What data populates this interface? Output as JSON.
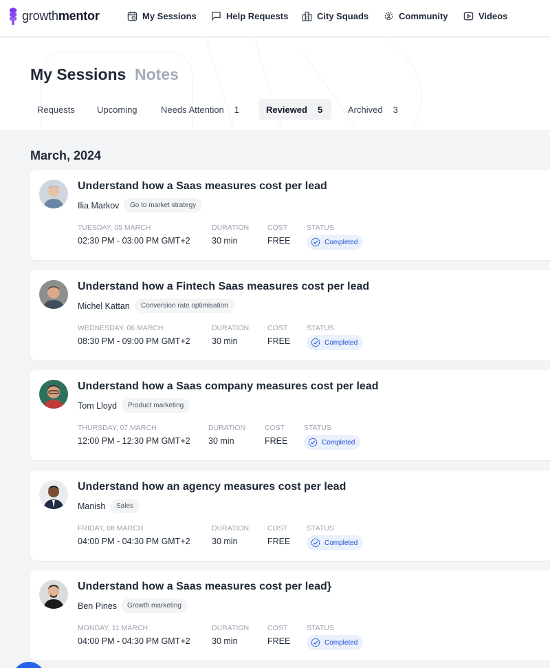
{
  "app": {
    "logo_light": "growth",
    "logo_bold": "mentor",
    "brand_color": "#7c3aed"
  },
  "nav": {
    "items": [
      {
        "label": "My Sessions",
        "icon": "calendar-icon"
      },
      {
        "label": "Help Requests",
        "icon": "chat-flag-icon"
      },
      {
        "label": "City Squads",
        "icon": "city-icon"
      },
      {
        "label": "Community",
        "icon": "gear-people-icon"
      },
      {
        "label": "Videos",
        "icon": "play-icon"
      }
    ]
  },
  "page": {
    "tabs": [
      {
        "label": "My Sessions",
        "active": true
      },
      {
        "label": "Notes",
        "active": false
      }
    ],
    "subtabs": [
      {
        "label": "Requests",
        "count": ""
      },
      {
        "label": "Upcoming",
        "count": ""
      },
      {
        "label": "Needs Attention",
        "count": "1"
      },
      {
        "label": "Reviewed",
        "count": "5",
        "active": true
      },
      {
        "label": "Archived",
        "count": "3"
      }
    ]
  },
  "month_heading": "March, 2024",
  "labels": {
    "duration": "DURATION",
    "cost": "COST",
    "status": "STATUS"
  },
  "sessions": [
    {
      "title": "Understand how a Saas measures cost per lead",
      "mentor": "Ilia Markov",
      "topic": "Go to market strategy",
      "date": "TUESDAY, 05 MARCH",
      "time": "02:30 PM - 03:00 PM GMT+2",
      "duration": "30 min",
      "cost": "FREE",
      "status": "Completed"
    },
    {
      "title": "Understand how a Fintech Saas measures cost per lead",
      "mentor": "Michel Kattan",
      "topic": "Conversion rate optimisation",
      "date": "WEDNESDAY, 06 MARCH",
      "time": "08:30 PM - 09:00 PM GMT+2",
      "duration": "30 min",
      "cost": "FREE",
      "status": "Completed"
    },
    {
      "title": "Understand how a Saas company measures cost per lead",
      "mentor": "Tom Lloyd",
      "topic": "Product marketing",
      "date": "THURSDAY, 07 MARCH",
      "time": "12:00 PM - 12:30 PM GMT+2",
      "duration": "30 min",
      "cost": "FREE",
      "status": "Completed"
    },
    {
      "title": "Understand how an agency measures cost per lead",
      "mentor": "Manish",
      "topic": "Sales",
      "date": "FRIDAY, 08 MARCH",
      "time": "04:00 PM - 04:30 PM GMT+2",
      "duration": "30 min",
      "cost": "FREE",
      "status": "Completed"
    },
    {
      "title": "Understand how a Saas measures cost per lead}",
      "mentor": "Ben Pines",
      "topic": "Growth marketing",
      "date": "MONDAY, 11 MARCH",
      "time": "04:00 PM - 04:30 PM GMT+2",
      "duration": "30 min",
      "cost": "FREE",
      "status": "Completed"
    }
  ]
}
